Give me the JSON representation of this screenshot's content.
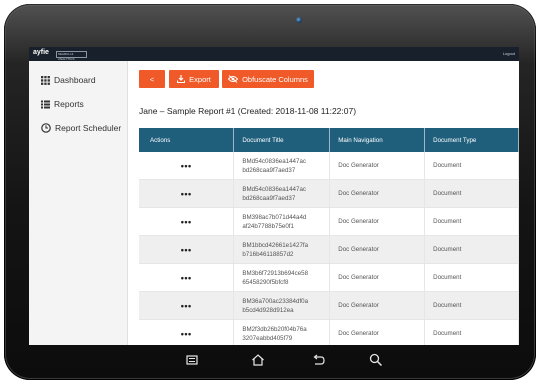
{
  "app": {
    "logo": "ayfie",
    "logo_sub": "SEARCH & ANALYTICS",
    "top_right": "Logout"
  },
  "sidebar": {
    "items": [
      {
        "label": "Dashboard",
        "icon": "grid-icon"
      },
      {
        "label": "Reports",
        "icon": "list-icon"
      },
      {
        "label": "Report Scheduler",
        "icon": "clock-icon"
      }
    ]
  },
  "toolbar": {
    "back_label": "<",
    "export_label": "Export",
    "obfuscate_label": "Obfuscate Columns"
  },
  "report": {
    "title": "Jane – Sample Report #1 (Created: 2018-11-08 11:22:07)"
  },
  "table": {
    "headers": [
      "Actions",
      "Document Title",
      "Main Navigation",
      "Document Type"
    ],
    "rows": [
      {
        "actions": "•••",
        "title_l1": "BMd54c0836ea1447ac",
        "title_l2": "bd268caa9f7aed37",
        "nav": "Doc Generator",
        "type": "Document"
      },
      {
        "actions": "•••",
        "title_l1": "BMd54c0836ea1447ac",
        "title_l2": "bd268caa9f7aed37",
        "nav": "Doc Generator",
        "type": "Document"
      },
      {
        "actions": "•••",
        "title_l1": "BM398ac7b071d44a4d",
        "title_l2": "af24b7788b75e0f1",
        "nav": "Doc Generator",
        "type": "Document"
      },
      {
        "actions": "•••",
        "title_l1": "BM1bbcd42661e1427fa",
        "title_l2": "b716b46118857d2",
        "nav": "Doc Generator",
        "type": "Document"
      },
      {
        "actions": "•••",
        "title_l1": "BM3b6f72913b694ce58",
        "title_l2": "65458290f5bfcf8",
        "nav": "Doc Generator",
        "type": "Document"
      },
      {
        "actions": "•••",
        "title_l1": "BM36a700ac23384df0a",
        "title_l2": "b5cd4d928d912ea",
        "nav": "Doc Generator",
        "type": "Document"
      },
      {
        "actions": "•••",
        "title_l1": "BM2f3db26b20f04b76a",
        "title_l2": "3207eabbd405f79",
        "nav": "Doc Generator",
        "type": "Document"
      }
    ]
  },
  "colors": {
    "accent": "#ef5a28",
    "table_header": "#1f5f7c",
    "topbar": "#17202b"
  },
  "device_nav": {
    "icons": [
      "recents-icon",
      "home-icon",
      "back-icon",
      "search-icon"
    ]
  }
}
